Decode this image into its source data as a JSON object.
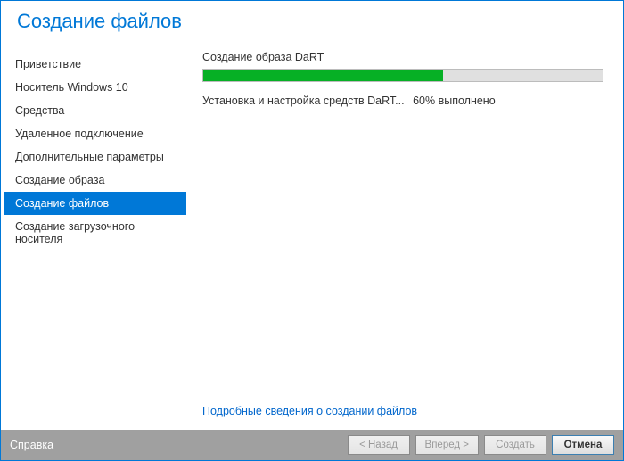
{
  "header": {
    "title": "Создание файлов"
  },
  "sidebar": {
    "items": [
      {
        "label": "Приветствие"
      },
      {
        "label": "Носитель Windows 10"
      },
      {
        "label": "Средства"
      },
      {
        "label": "Удаленное подключение"
      },
      {
        "label": "Дополнительные параметры"
      },
      {
        "label": "Создание образа"
      },
      {
        "label": "Создание файлов",
        "active": true
      },
      {
        "label": "Создание загрузочного носителя"
      }
    ]
  },
  "main": {
    "section_title": "Создание образа DaRT",
    "progress_percent": 60,
    "status_text": "Установка и настройка средств DaRT...",
    "status_pct": "60% выполнено",
    "details_link": "Подробные сведения о создании файлов"
  },
  "footer": {
    "help": "Справка",
    "back": "< Назад",
    "next": "Вперед >",
    "create": "Создать",
    "cancel": "Отмена"
  }
}
